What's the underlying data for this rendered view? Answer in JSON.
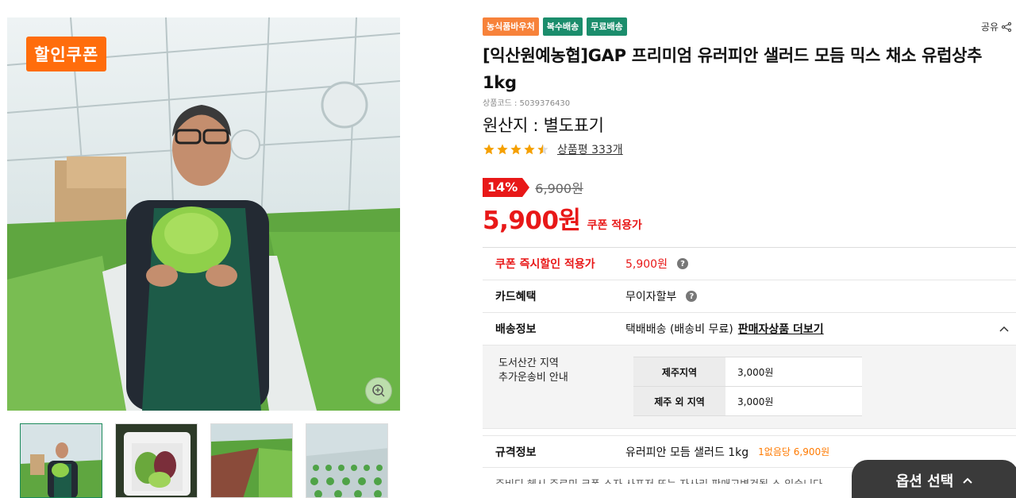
{
  "gallery": {
    "coupon_badge": "할인쿠폰"
  },
  "product": {
    "badges": [
      "농식품바우처",
      "복수배송",
      "무료배송"
    ],
    "share_label": "공유",
    "title": "[익산원예농협]GAP 프리미엄 유러피안 샐러드 모듬 믹스 채소 유럽상추 1kg",
    "code": "상품코드 : 5039376430",
    "origin": "원산지 : 별도표기",
    "rating_value": 4.5,
    "review_link": "상품평 333개",
    "discount_pct": "14%",
    "original_price": "6,900원",
    "price": "5,900원",
    "price_note": "쿠폰 적용가"
  },
  "info_table": {
    "coupon": {
      "label": "쿠폰 즉시할인 적용가",
      "value": "5,900원"
    },
    "card": {
      "label": "카드혜택",
      "value": "무이자할부"
    },
    "shipping": {
      "label": "배송정보",
      "value": "택배배송  (배송비 무료)",
      "seller_link": "판매자상품 더보기",
      "extra_title_1": "도서산간 지역",
      "extra_title_2": "추가운송비 안내",
      "fees": [
        {
          "region": "제주지역",
          "fee": "3,000원"
        },
        {
          "region": "제주 외 지역",
          "fee": "3,000원"
        }
      ]
    },
    "spec": {
      "label": "규격정보",
      "value": "유러피안 모듬 샐러드 1kg",
      "unit_price": "1없음당 6,900원"
    },
    "cut_text": "주비디 헤시 주르미 크폰 스자 사표저 또는 자사리 판매고변건될 스 있습니다"
  },
  "option_button": "옵션 선택",
  "colors": {
    "accent_red": "#e81818",
    "coupon_orange": "#ff6d0c",
    "badge_green": "#1b8d6c",
    "star": "#f5a000"
  }
}
